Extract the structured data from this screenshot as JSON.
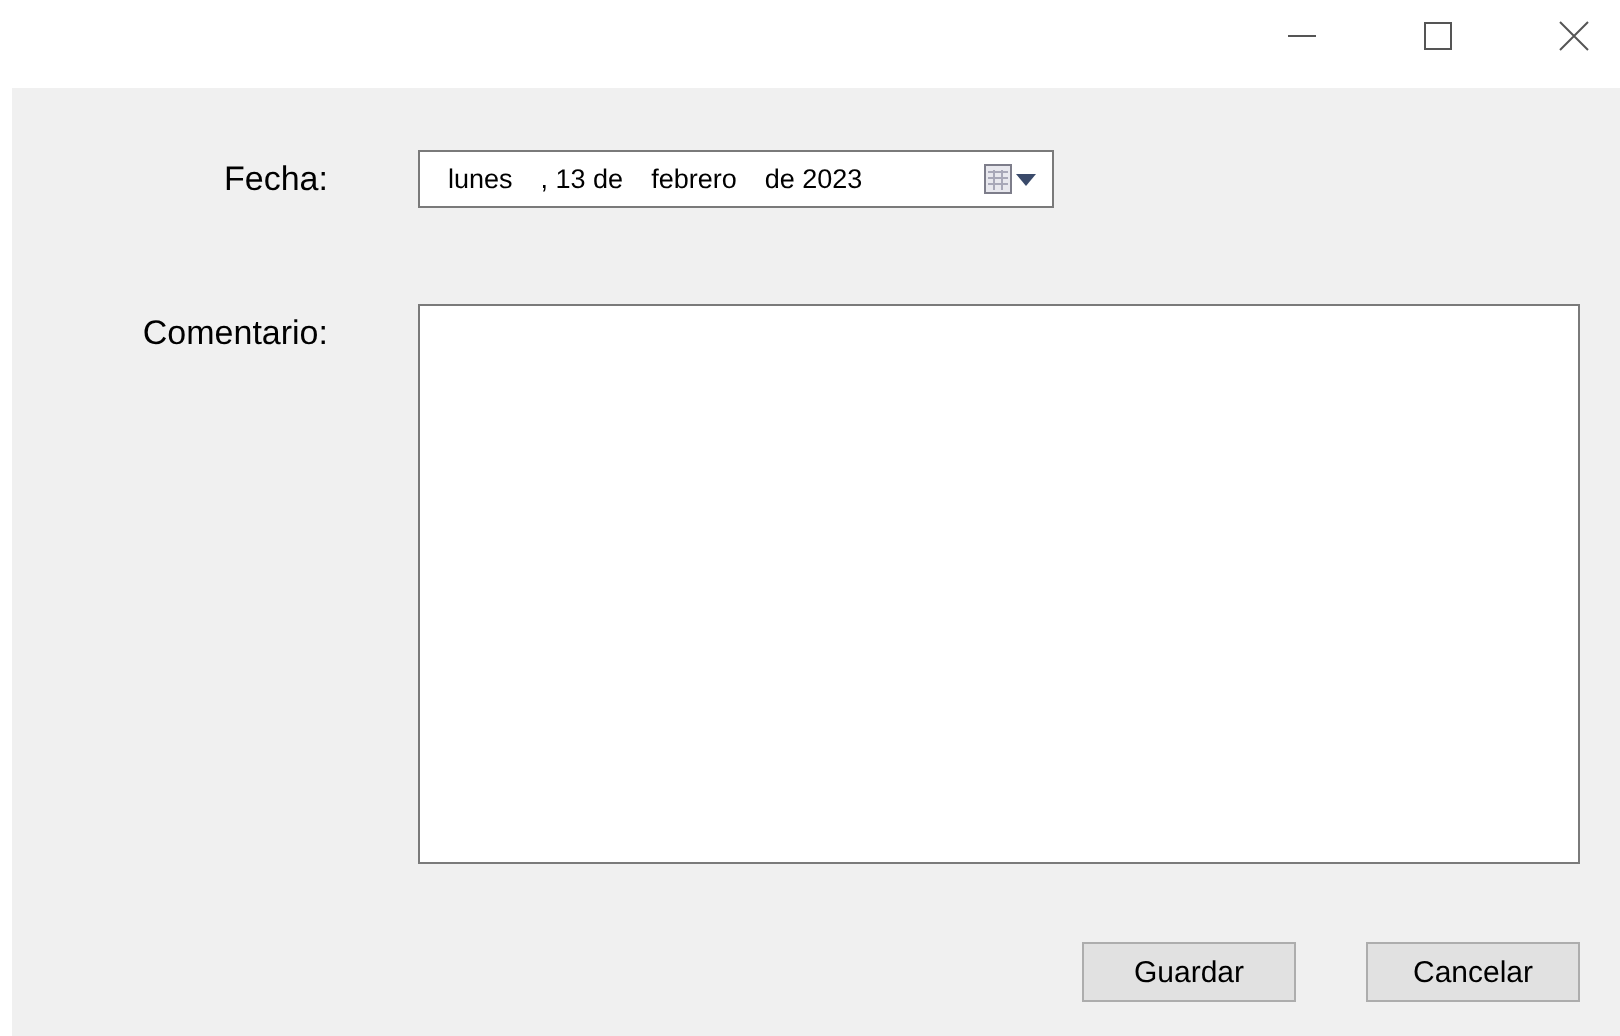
{
  "window": {
    "controls": [
      {
        "kind": "minimize"
      },
      {
        "kind": "maximize"
      },
      {
        "kind": "close"
      }
    ]
  },
  "date_field": {
    "label": "Fecha:",
    "parts": [
      "lunes",
      ", 13 de",
      "febrero",
      "de 2023"
    ]
  },
  "comment_field": {
    "label": "Comentario:"
  },
  "buttons": [
    "Guardar",
    "Cancelar"
  ]
}
